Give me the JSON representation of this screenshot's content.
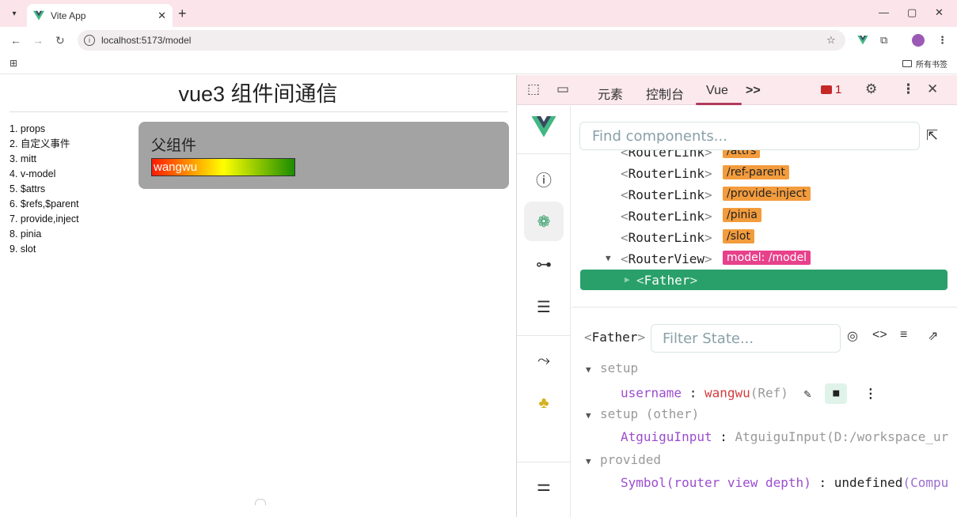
{
  "browser": {
    "tab_title": "Vite App",
    "tab_close": "✕",
    "new_tab": "+",
    "url": "localhost:5173/model",
    "bookmarks_all": "所有书签",
    "window_controls": {
      "minimize": "—",
      "maximize": "▢",
      "close": "✕"
    }
  },
  "page": {
    "title": "vue3 组件间通信",
    "nav_items": [
      "1. props",
      "2. 自定义事件",
      "3. mitt",
      "4. v-model",
      "5. $attrs",
      "6. $refs,$parent",
      "7. provide,inject",
      "8. pinia",
      "9. slot"
    ],
    "father_title": "父组件",
    "input_value": "wangwu"
  },
  "devtools": {
    "tabs": {
      "elements": "元素",
      "console": "控制台",
      "vue": "Vue",
      "more": ">>"
    },
    "issues_count": "1",
    "find_placeholder": "Find components...",
    "tree": [
      {
        "tag": "RouterLink",
        "badge": "/attrs"
      },
      {
        "tag": "RouterLink",
        "badge": "/ref-parent"
      },
      {
        "tag": "RouterLink",
        "badge": "/provide-inject"
      },
      {
        "tag": "RouterLink",
        "badge": "/pinia"
      },
      {
        "tag": "RouterLink",
        "badge": "/slot"
      },
      {
        "tag": "RouterView",
        "badge": "model: /model"
      },
      {
        "tag": "Father",
        "badge": ""
      }
    ],
    "selected_component": "Father",
    "filter_placeholder": "Filter State...",
    "state": {
      "setup_label": "setup",
      "username_key": "username",
      "username_value": "wangwu",
      "username_type": "(Ref)",
      "setup_other_label": "setup (other)",
      "atguigu_key": "AtguiguInput",
      "atguigu_value": "AtguiguInput(D:/workspace_ur",
      "provided_label": "provided",
      "symbol_key": "Symbol(router view depth)",
      "symbol_value": "undefined",
      "symbol_suffix": "(Compu"
    }
  }
}
